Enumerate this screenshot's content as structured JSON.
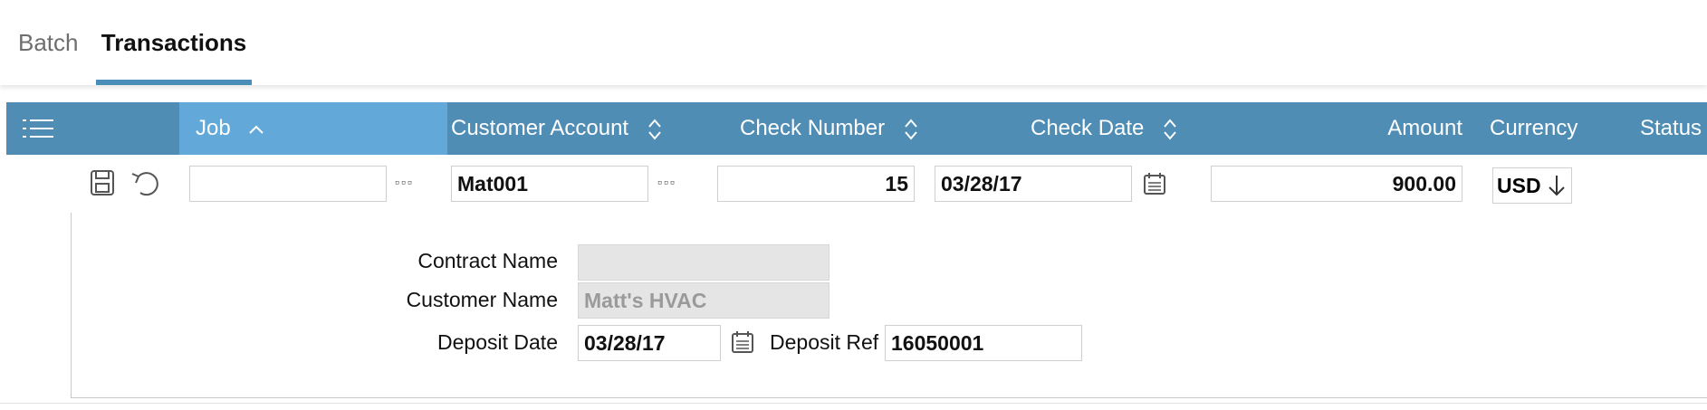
{
  "tabs": [
    {
      "label": "Batch",
      "active": false
    },
    {
      "label": "Transactions",
      "active": true
    }
  ],
  "grid": {
    "menu_icon": "hamburger-menu-icon",
    "columns": {
      "job": {
        "label": "Job",
        "sort": "ascending"
      },
      "customer_account": {
        "label": "Customer Account",
        "sort": "unsorted"
      },
      "check_number": {
        "label": "Check Number",
        "sort": "unsorted"
      },
      "check_date": {
        "label": "Check Date",
        "sort": "unsorted"
      },
      "amount": {
        "label": "Amount"
      },
      "currency": {
        "label": "Currency"
      },
      "status": {
        "label": "Status"
      }
    },
    "header_color": "#4f8db5",
    "active_header_color": "#62a9d9"
  },
  "edit_row": {
    "save_icon": "save-icon",
    "undo_icon": "undo-icon",
    "job_value": "",
    "lookup_dots": "▫▫▫",
    "customer_account_value": "Mat001",
    "check_number_value": "15",
    "check_date_value": "03/28/17",
    "calendar_icon": "calendar-icon",
    "amount_value": "900.00",
    "currency_value": "USD",
    "currency_arrow_icon": "arrow-down-icon"
  },
  "detail": {
    "contract_name_label": "Contract Name",
    "contract_name_value": "",
    "customer_name_label": "Customer Name",
    "customer_name_value": "Matt's HVAC",
    "deposit_date_label": "Deposit Date",
    "deposit_date_value": "03/28/17",
    "deposit_ref_label": "Deposit Ref",
    "deposit_ref_value": "16050001"
  },
  "accent_color": "#4a8db8"
}
